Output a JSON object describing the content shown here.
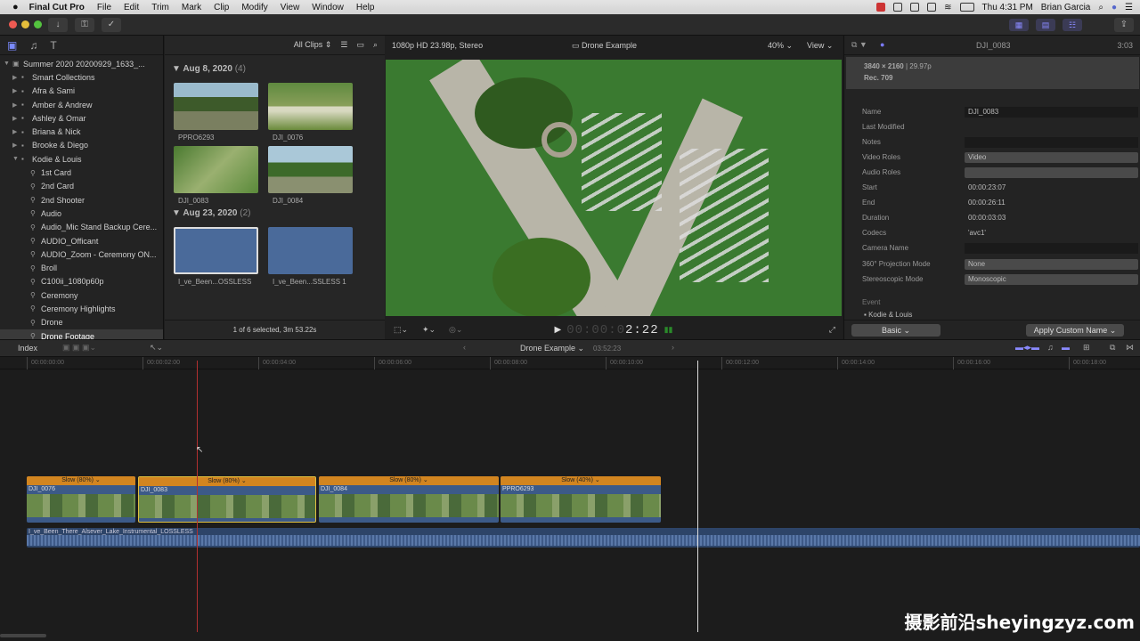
{
  "menubar": {
    "app": "Final Cut Pro",
    "items": [
      "File",
      "Edit",
      "Trim",
      "Mark",
      "Clip",
      "Modify",
      "View",
      "Window",
      "Help"
    ],
    "clock": "Thu 4:31 PM",
    "user": "Brian Garcia"
  },
  "library": {
    "items": [
      {
        "label": "Summer 2020 20200929_1633_...",
        "level": 0,
        "icon": "library-icon",
        "tri": "▼",
        "selected": false
      },
      {
        "label": "Smart Collections",
        "level": 1,
        "icon": "folder-icon",
        "tri": "▶",
        "selected": false
      },
      {
        "label": "Afra & Sami",
        "level": 1,
        "icon": "event-icon",
        "tri": "▶",
        "selected": false
      },
      {
        "label": "Amber & Andrew",
        "level": 1,
        "icon": "event-icon",
        "tri": "▶",
        "selected": false
      },
      {
        "label": "Ashley & Omar",
        "level": 1,
        "icon": "event-icon",
        "tri": "▶",
        "selected": false
      },
      {
        "label": "Briana & Nick",
        "level": 1,
        "icon": "event-icon",
        "tri": "▶",
        "selected": false
      },
      {
        "label": "Brooke & Diego",
        "level": 1,
        "icon": "event-icon",
        "tri": "▶",
        "selected": false
      },
      {
        "label": "Kodie & Louis",
        "level": 1,
        "icon": "event-icon",
        "tri": "▼",
        "selected": false
      },
      {
        "label": "1st Card",
        "level": 2,
        "icon": "keyword-icon",
        "tri": "",
        "selected": false
      },
      {
        "label": "2nd Card",
        "level": 2,
        "icon": "keyword-icon",
        "tri": "",
        "selected": false
      },
      {
        "label": "2nd Shooter",
        "level": 2,
        "icon": "keyword-icon",
        "tri": "",
        "selected": false
      },
      {
        "label": "Audio",
        "level": 2,
        "icon": "keyword-icon",
        "tri": "",
        "selected": false
      },
      {
        "label": "Audio_Mic Stand Backup Cere...",
        "level": 2,
        "icon": "keyword-icon",
        "tri": "",
        "selected": false
      },
      {
        "label": "AUDIO_Officant",
        "level": 2,
        "icon": "keyword-icon",
        "tri": "",
        "selected": false
      },
      {
        "label": "AUDIO_Zoom - Ceremony ON...",
        "level": 2,
        "icon": "keyword-icon",
        "tri": "",
        "selected": false
      },
      {
        "label": "Broll",
        "level": 2,
        "icon": "keyword-icon",
        "tri": "",
        "selected": false
      },
      {
        "label": "C100ii_1080p60p",
        "level": 2,
        "icon": "keyword-icon",
        "tri": "",
        "selected": false
      },
      {
        "label": "Ceremony",
        "level": 2,
        "icon": "keyword-icon",
        "tri": "",
        "selected": false
      },
      {
        "label": "Ceremony Highlights",
        "level": 2,
        "icon": "keyword-icon",
        "tri": "",
        "selected": false
      },
      {
        "label": "Drone",
        "level": 2,
        "icon": "keyword-icon",
        "tri": "",
        "selected": false
      },
      {
        "label": "Drone Footage",
        "level": 2,
        "icon": "keyword-icon",
        "tri": "",
        "selected": true
      }
    ]
  },
  "browser": {
    "filter": "All Clips",
    "groups": [
      {
        "title": "Aug 8, 2020",
        "count": "(4)"
      },
      {
        "title": "Aug 23, 2020",
        "count": "(2)"
      }
    ],
    "clips": [
      "PPRO6293",
      "DJI_0076",
      "DJI_0083",
      "DJI_0084",
      "I_ve_Been...OSSLESS",
      "I_ve_Been...SSLESS 1"
    ],
    "status": "1 of 6 selected, 3m 53.22s"
  },
  "viewer": {
    "format": "1080p HD 23.98p, Stereo",
    "title": "Drone Example",
    "zoom": "40%",
    "view": "View",
    "timecode_dim": "00:00:0",
    "timecode_bright": "2:22"
  },
  "inspector": {
    "clip": "DJI_0083",
    "duration_short": "3:03",
    "resolution": "3840 × 2160",
    "fps": "29.97p",
    "colorspace": "Rec. 709",
    "rows": [
      {
        "key": "Name",
        "value": "DJI_0083",
        "style": "box"
      },
      {
        "key": "Last Modified",
        "value": "",
        "style": ""
      },
      {
        "key": "Notes",
        "value": "",
        "style": "box"
      },
      {
        "key": "Video Roles",
        "value": "Video",
        "style": "sel"
      },
      {
        "key": "Audio Roles",
        "value": "",
        "style": "sel"
      },
      {
        "key": "Start",
        "value": "00:00:23:07",
        "style": ""
      },
      {
        "key": "End",
        "value": "00:00:26:11",
        "style": ""
      },
      {
        "key": "Duration",
        "value": "00:00:03:03",
        "style": ""
      },
      {
        "key": "Codecs",
        "value": "'avc1'",
        "style": ""
      },
      {
        "key": "Camera Name",
        "value": "",
        "style": "box"
      },
      {
        "key": "360° Projection Mode",
        "value": "None",
        "style": "sel"
      },
      {
        "key": "Stereoscopic Mode",
        "value": "Monoscopic",
        "style": "sel"
      }
    ],
    "event_label": "Event",
    "event_value": "Kodie & Louis",
    "basic": "Basic",
    "apply": "Apply Custom Name"
  },
  "timeline": {
    "index": "Index",
    "project": "Drone Example",
    "duration": "03:52:23",
    "ticks": [
      "00:00:00:00",
      "00:00:02:00",
      "00:00:04:00",
      "00:00:06:00",
      "00:00:08:00",
      "00:00:10:00",
      "00:00:12:00",
      "00:00:14:00",
      "00:00:16:00",
      "00:00:18:00"
    ],
    "clips": [
      {
        "name": "DJI_0076",
        "speed": "Slow (80%) ⌄"
      },
      {
        "name": "DJI_0083",
        "speed": "Slow (80%) ⌄"
      },
      {
        "name": "DJI_0084",
        "speed": "Slow (80%) ⌄"
      },
      {
        "name": "PPRO6293",
        "speed": "Slow (40%) ⌄"
      }
    ],
    "audio": "I_ve_Been_There_Alsever_Lake_Instrumental_LOSSLESS"
  },
  "watermark": "摄影前沿sheyingzyz.com"
}
